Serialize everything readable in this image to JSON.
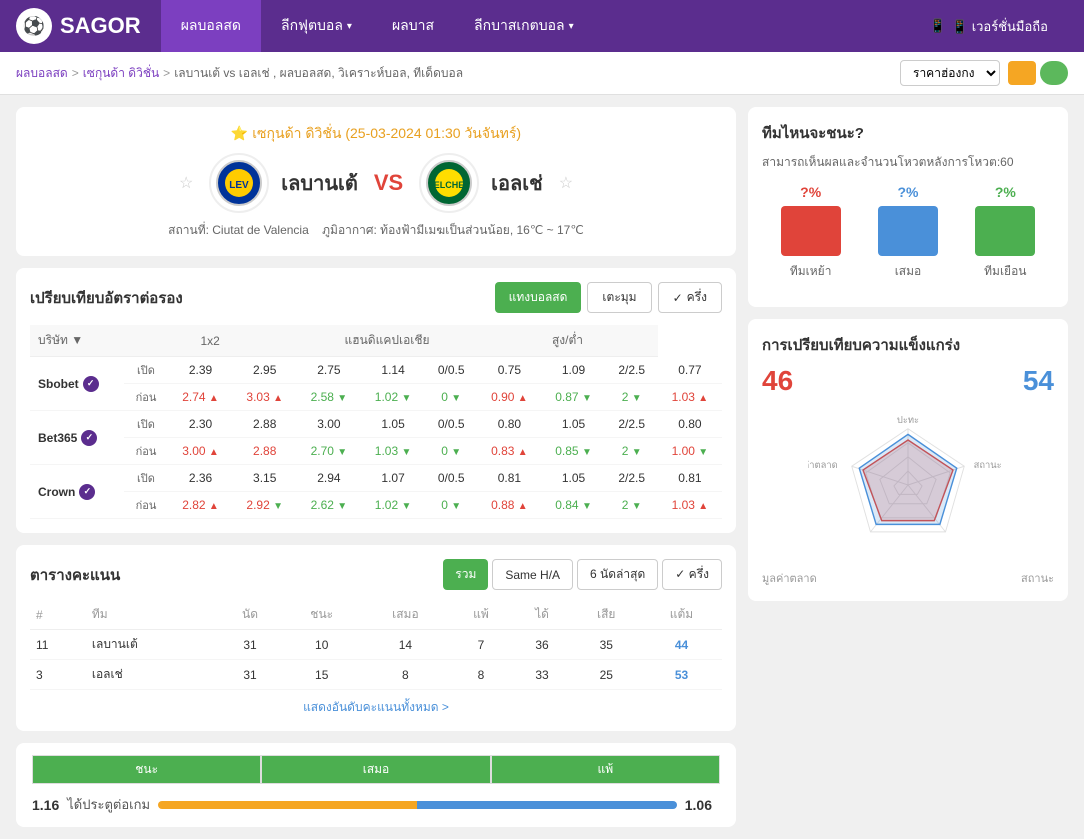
{
  "header": {
    "logo_text": "SAGOR",
    "nav": [
      {
        "label": "ผลบอลสด",
        "active": true,
        "has_arrow": false
      },
      {
        "label": "ลีกฟุตบอล",
        "has_arrow": true
      },
      {
        "label": "ผลบาส",
        "has_arrow": false
      },
      {
        "label": "ลีกบาสเกตบอล",
        "has_arrow": true
      },
      {
        "label": "📱 เวอร์ชั่นมือถือ",
        "has_arrow": false
      }
    ]
  },
  "breadcrumb": {
    "items": [
      "ผลบอลสด",
      "เซกุนด้า ดิวิชั่น",
      "เลบานเต้ vs เอลเช่ , ผลบอลสด, วิเคราะห์บอล, ทีเด็ดบอล"
    ],
    "price_label": "ราคาฮ่องกง"
  },
  "match": {
    "league": "เซกุนด้า ดิวิชั่น",
    "date": "25-03-2024 01:30 วันจันทร์",
    "home_team": "เลบานเต้",
    "away_team": "เอลเช่",
    "vs": "VS",
    "stadium": "Ciutat de Valencia",
    "weather": "ท้องฟ้ามีเมฆเป็นส่วนน้อย, 16℃ ~ 17℃"
  },
  "odds_section": {
    "title": "เปรียบเทียบอัตราต่อรอง",
    "btn_live": "แทงบอลสด",
    "btn_detail": "เตะมุม",
    "btn_half": "ครึ่ง",
    "col_company": "บริษัท",
    "col_1x2": "1x2",
    "col_handicap": "แฮนดิแคปเอเชีย",
    "col_high_low": "สูง/ต่ำ",
    "companies": [
      {
        "name": "Sbobet",
        "open_label": "เปิด",
        "close_label": "ก่อน",
        "h1_open": "2.39",
        "h2_open": "2.95",
        "h3_open": "2.75",
        "h1_close": "2.74",
        "h2_close": "3.03",
        "h3_close": "2.58",
        "h1_close_arr": "up",
        "h2_close_arr": "up",
        "h3_close_arr": "down",
        "hcap_open": "1.14",
        "hcap_line_open": "0/0.5",
        "hcap_low_open": "0.75",
        "hcap_close": "1.02",
        "hcap_line_close": "0",
        "hcap_low_close": "0.90",
        "hcap_close_arr": "down",
        "hcap_line_close_arr": "down",
        "hcap_low_close_arr": "up",
        "hl1_open": "1.09",
        "hl_line_open": "2/2.5",
        "hl2_open": "0.77",
        "hl1_close": "0.87",
        "hl_line_close": "2",
        "hl2_close": "1.03",
        "hl1_close_arr": "down",
        "hl_line_close_arr": "down",
        "hl2_close_arr": "up"
      },
      {
        "name": "Bet365",
        "open_label": "เปิด",
        "close_label": "ก่อน",
        "h1_open": "2.30",
        "h2_open": "2.88",
        "h3_open": "3.00",
        "h1_close": "3.00",
        "h2_close": "2.88",
        "h3_close": "2.70",
        "h1_close_arr": "up",
        "h2_close_arr": "none",
        "h3_close_arr": "down",
        "hcap_open": "1.05",
        "hcap_line_open": "0/0.5",
        "hcap_low_open": "0.80",
        "hcap_close": "1.03",
        "hcap_line_close": "0",
        "hcap_low_close": "0.83",
        "hcap_close_arr": "down",
        "hcap_line_close_arr": "down",
        "hcap_low_close_arr": "up",
        "hl1_open": "1.05",
        "hl_line_open": "2/2.5",
        "hl2_open": "0.80",
        "hl1_close": "0.85",
        "hl_line_close": "2",
        "hl2_close": "1.00",
        "hl1_close_arr": "down",
        "hl_line_close_arr": "down",
        "hl2_close_arr": "down"
      },
      {
        "name": "Crown",
        "open_label": "เปิด",
        "close_label": "ก่อน",
        "h1_open": "2.36",
        "h2_open": "3.15",
        "h3_open": "2.94",
        "h1_close": "2.82",
        "h2_close": "2.92",
        "h3_close": "2.62",
        "h1_close_arr": "up",
        "h2_close_arr": "down",
        "h3_close_arr": "down",
        "hcap_open": "1.07",
        "hcap_line_open": "0/0.5",
        "hcap_low_open": "0.81",
        "hcap_close": "1.02",
        "hcap_line_close": "0",
        "hcap_low_close": "0.88",
        "hcap_close_arr": "down",
        "hcap_line_close_arr": "down",
        "hcap_low_close_arr": "up",
        "hl1_open": "1.05",
        "hl_line_open": "2/2.5",
        "hl2_open": "0.81",
        "hl1_close": "0.84",
        "hl_line_close": "2",
        "hl2_close": "1.03",
        "hl1_close_arr": "down",
        "hl_line_close_arr": "down",
        "hl2_close_arr": "up"
      }
    ]
  },
  "standings": {
    "title": "ตารางคะแนน",
    "tabs": [
      "รวม",
      "Same H/A",
      "6 นัดล่าสุด"
    ],
    "active_tab": 0,
    "col_headers": [
      "#",
      "ทีม",
      "นัด",
      "ชนะ",
      "เสมอ",
      "แพ้",
      "ได้",
      "เสีย",
      "แต้ม"
    ],
    "rows": [
      {
        "rank": "11",
        "team": "เลบานเต้",
        "played": "31",
        "won": "10",
        "drawn": "14",
        "lost": "7",
        "gf": "36",
        "ga": "35",
        "pts": "44"
      },
      {
        "rank": "3",
        "team": "เอลเช่",
        "played": "31",
        "won": "15",
        "drawn": "8",
        "lost": "8",
        "gf": "33",
        "ga": "25",
        "pts": "53"
      }
    ],
    "show_all": "แสดงอันดับคะแนนทั้งหมด >"
  },
  "bottom_bar": {
    "win_label": "ชนะ",
    "draw_label": "เสมอ",
    "lose_label": "แพ้",
    "score_left": "1.16",
    "score_right": "1.06",
    "score_desc": "ได้ประตูต่อเกม",
    "prog_orange": 50,
    "prog_blue": 50
  },
  "right_panel": {
    "predict_title": "ทีมไหนจะชนะ?",
    "predict_subtitle": "สามารถเห็นผลและจำนวนโหวตหลังการโหวต:60",
    "predict_items": [
      {
        "pct": "?%",
        "color": "red",
        "label": "ทีมเหย้า"
      },
      {
        "pct": "?%",
        "color": "blue",
        "label": "เสมอ"
      },
      {
        "pct": "?%",
        "color": "green",
        "label": "ทีมเยือน"
      }
    ],
    "strength_title": "การเปรียบเทียบความแข็งแกร่ง",
    "strength_left": "46",
    "strength_right": "54",
    "radar_labels": [
      "ปะทะ",
      "สถานะ",
      "มูลค่าตลาด"
    ]
  }
}
